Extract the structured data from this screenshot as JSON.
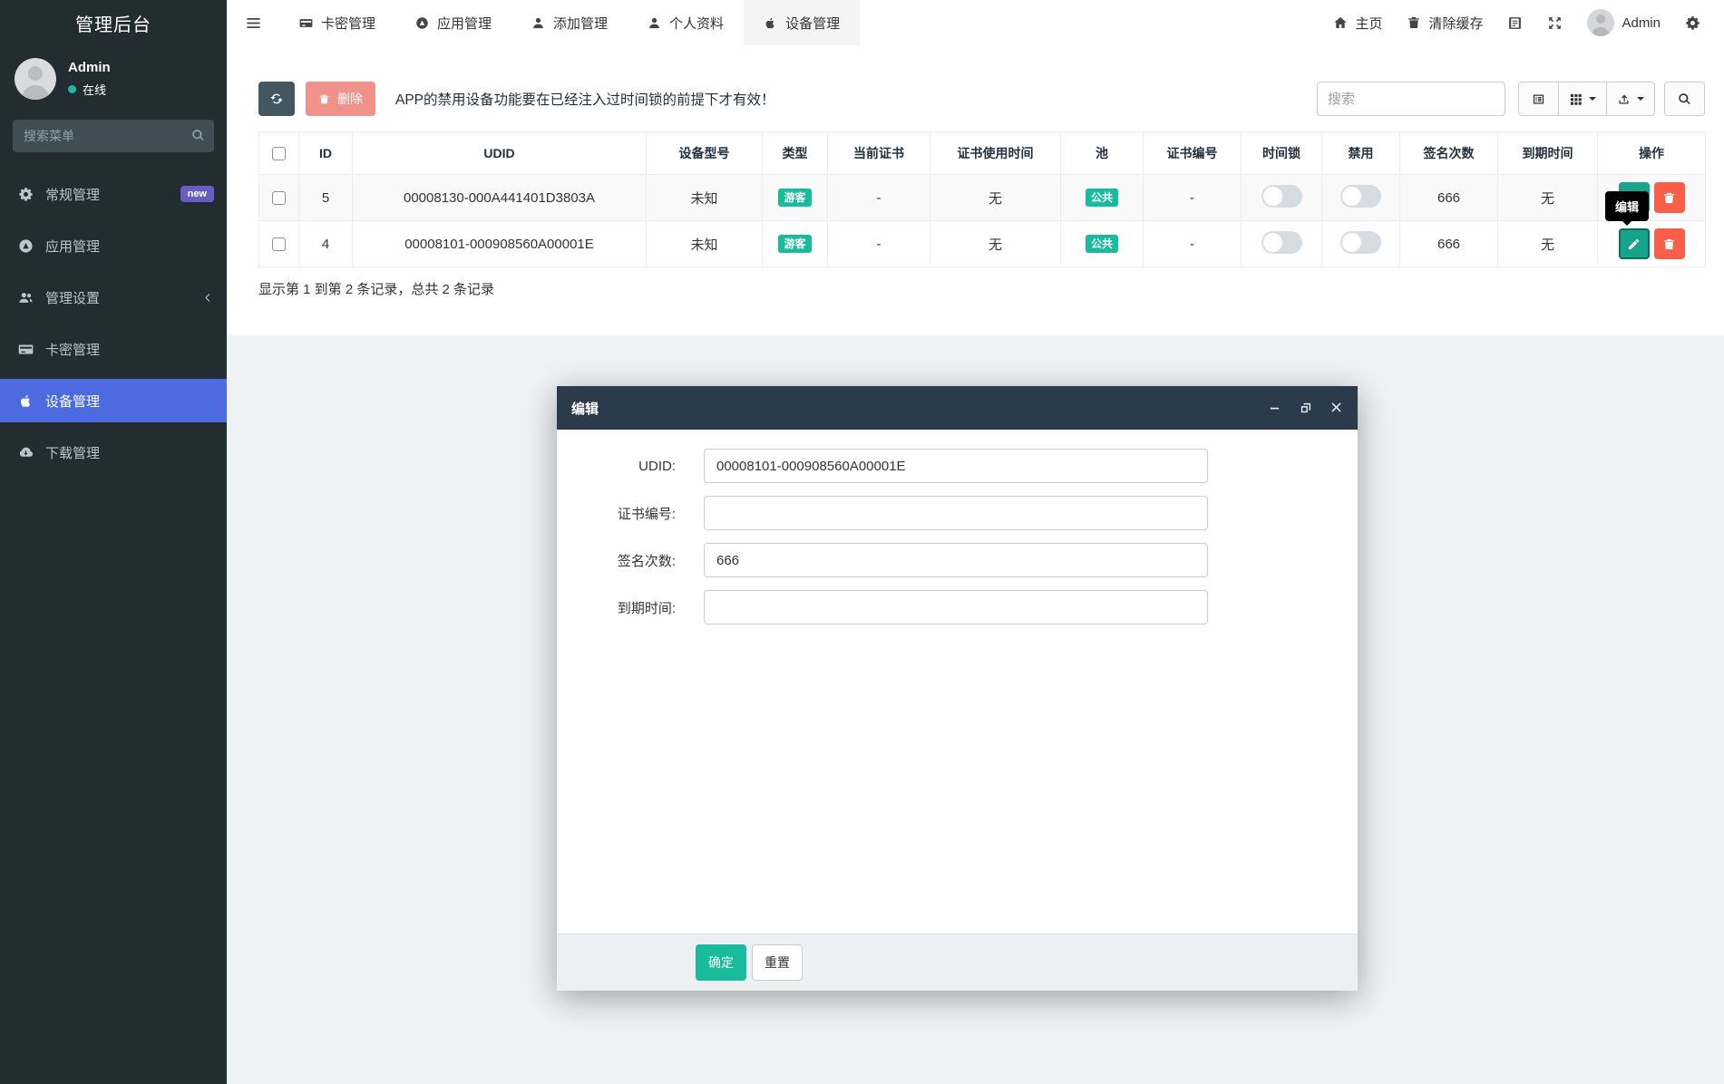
{
  "sidebar": {
    "title": "管理后台",
    "user": {
      "name": "Admin",
      "status": "在线"
    },
    "search_placeholder": "搜索菜单",
    "items": [
      {
        "label": "常规管理",
        "icon": "gears-icon",
        "badge": "new"
      },
      {
        "label": "应用管理",
        "icon": "app-circle-icon"
      },
      {
        "label": "管理设置",
        "icon": "users-icon",
        "chevron": "angle-left"
      },
      {
        "label": "卡密管理",
        "icon": "credit-card-icon"
      },
      {
        "label": "设备管理",
        "icon": "apple-icon",
        "active": true
      },
      {
        "label": "下载管理",
        "icon": "cloud-download-icon"
      }
    ]
  },
  "topnav": {
    "tabs": [
      {
        "label": "卡密管理",
        "icon": "credit-card-icon"
      },
      {
        "label": "应用管理",
        "icon": "app-circle-icon"
      },
      {
        "label": "添加管理",
        "icon": "user-icon"
      },
      {
        "label": "个人资料",
        "icon": "user-icon"
      },
      {
        "label": "设备管理",
        "icon": "apple-icon",
        "active": true
      }
    ],
    "right": {
      "home_label": "主页",
      "clear_cache_label": "清除缓存",
      "username": "Admin",
      "icons": [
        "language-icon",
        "fullscreen-icon",
        "gears-icon"
      ]
    }
  },
  "toolbar": {
    "delete_label": "删除",
    "notice": "APP的禁用设备功能要在已经注入过时间锁的前提下才有效！",
    "search_placeholder": "搜索"
  },
  "table": {
    "headers": [
      "ID",
      "UDID",
      "设备型号",
      "类型",
      "当前证书",
      "证书使用时间",
      "池",
      "证书编号",
      "时间锁",
      "禁用",
      "签名次数",
      "到期时间",
      "操作"
    ],
    "rows": [
      {
        "id": "5",
        "udid": "00008130-000A441401D3803A",
        "model": "未知",
        "type_badge": "游客",
        "current_cert": "-",
        "cert_time": "无",
        "pool_badge": "公共",
        "cert_no": "-",
        "sign_count": "666",
        "expire": "无"
      },
      {
        "id": "4",
        "udid": "00008101-000908560A00001E",
        "model": "未知",
        "type_badge": "游客",
        "current_cert": "-",
        "cert_time": "无",
        "pool_badge": "公共",
        "cert_no": "-",
        "sign_count": "666",
        "expire": "无"
      }
    ],
    "edit_tooltip": "编辑",
    "summary": "显示第 1 到第 2 条记录，总共 2 条记录"
  },
  "modal": {
    "title": "编辑",
    "fields": [
      {
        "label": "UDID:",
        "value": "00008101-000908560A00001E"
      },
      {
        "label": "证书编号:",
        "value": ""
      },
      {
        "label": "签名次数:",
        "value": "666"
      },
      {
        "label": "到期时间:",
        "value": ""
      }
    ],
    "confirm_label": "确定",
    "reset_label": "重置"
  },
  "colors": {
    "sidebar_bg": "#222d32",
    "active_menu_blue": "#4d6be0",
    "accent_green": "#18bc9c",
    "edit_green": "#17a589",
    "delete_red": "#f95e48",
    "delete_btn_salmon": "#f0918a",
    "refresh_btn_slate": "#445761",
    "modal_header_navy": "#2c3b4c",
    "badge_purple": "#685dc5"
  }
}
